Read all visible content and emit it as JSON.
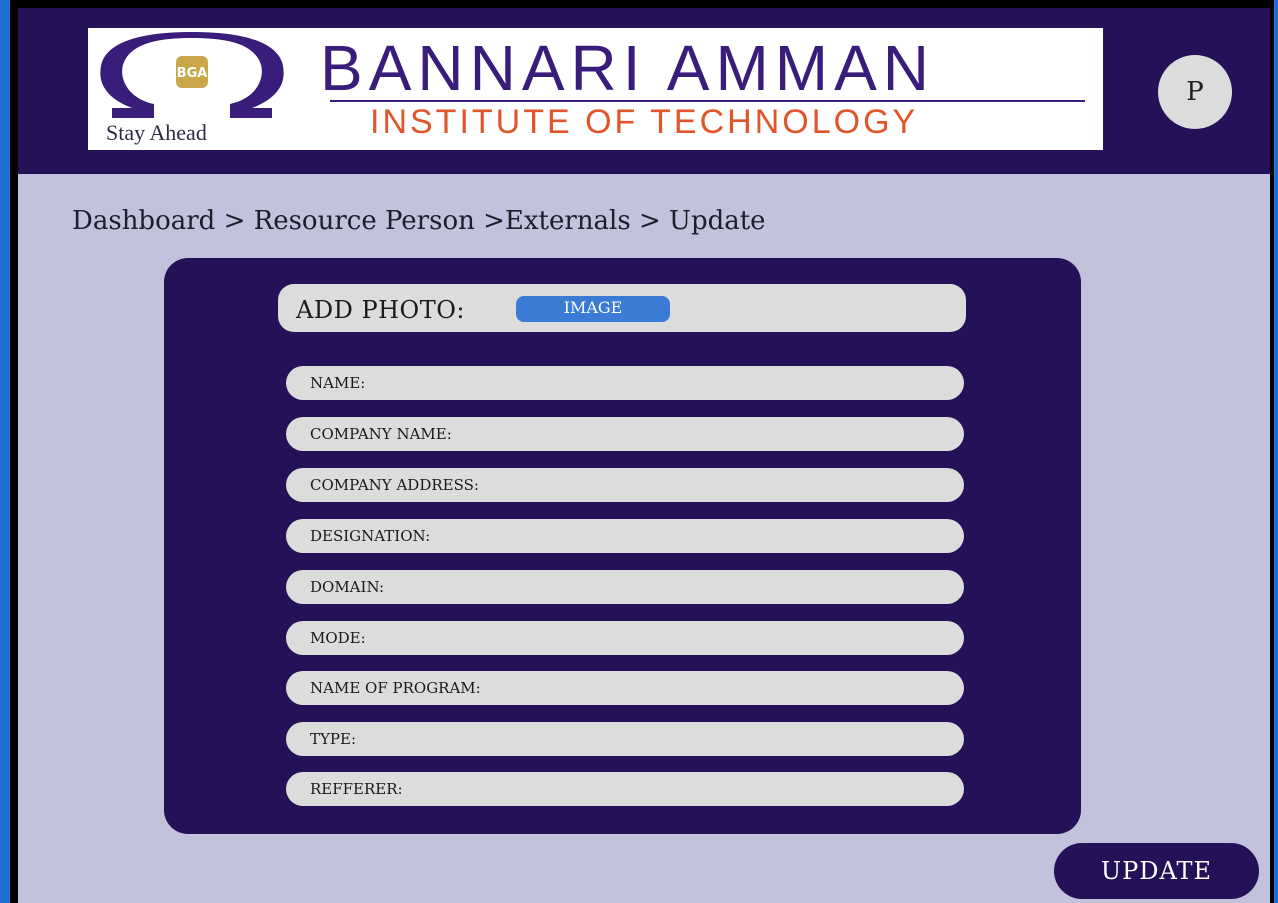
{
  "header": {
    "logo": {
      "emblem_letters": "BGA",
      "tagline": "Stay Ahead",
      "brand_name": "BANNARI AMMAN",
      "brand_subtitle": "INSTITUTE OF TECHNOLOGY"
    },
    "profile_initial": "P"
  },
  "breadcrumb": [
    "Dashboard > ",
    "Resource Person >",
    "Externals > ",
    "Update"
  ],
  "form": {
    "photo_label": "ADD PHOTO:",
    "image_button": "IMAGE",
    "fields": [
      "NAME:",
      "COMPANY NAME:",
      "COMPANY ADDRESS:",
      "DESIGNATION:",
      "DOMAIN:",
      "MODE:",
      "NAME OF PROGRAM:",
      "TYPE:",
      "REFFERER:"
    ]
  },
  "update_button": "UPDATE",
  "colors": {
    "header_bg": "#251157",
    "page_bg": "#c3c2dc",
    "field_bg": "#dcdcdc",
    "image_button": "#3a7bd5",
    "brand_purple": "#3a1c7a",
    "brand_orange": "#e0562a"
  }
}
